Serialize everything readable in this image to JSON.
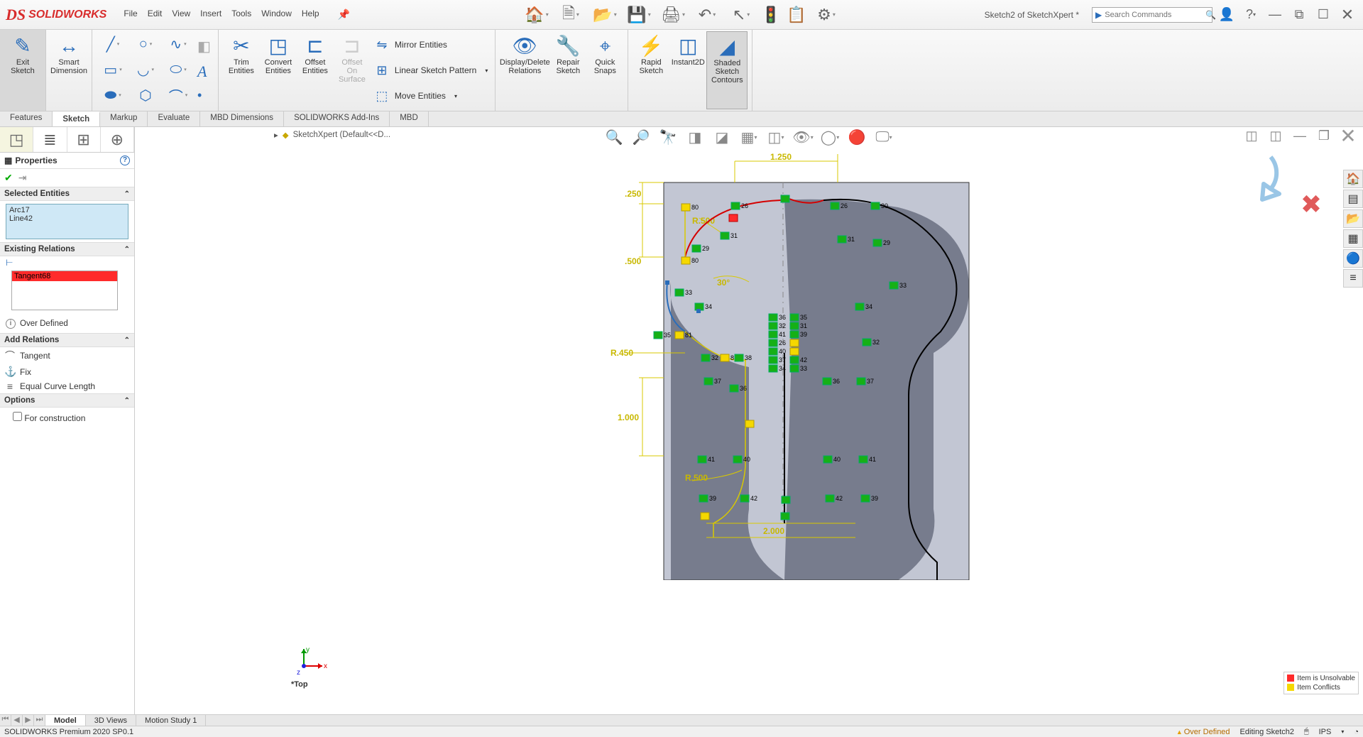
{
  "app": {
    "name": "SOLIDWORKS"
  },
  "menu": [
    "File",
    "Edit",
    "View",
    "Insert",
    "Tools",
    "Window",
    "Help"
  ],
  "doc_title": "Sketch2 of SketchXpert *",
  "search_placeholder": "Search Commands",
  "ribbon": {
    "exit_sketch": "Exit\nSketch",
    "smart_dim": "Smart\nDimension",
    "trim": "Trim\nEntities",
    "convert": "Convert\nEntities",
    "offset": "Offset\nEntities",
    "offset_surf": "Offset\nOn\nSurface",
    "mirror": "Mirror Entities",
    "linear": "Linear Sketch Pattern",
    "move": "Move Entities",
    "display_del": "Display/Delete\nRelations",
    "repair": "Repair\nSketch",
    "quick_snaps": "Quick\nSnaps",
    "rapid": "Rapid\nSketch",
    "instant2d": "Instant2D",
    "shaded": "Shaded\nSketch\nContours"
  },
  "ribbon_tabs": [
    "Features",
    "Sketch",
    "Markup",
    "Evaluate",
    "MBD Dimensions",
    "SOLIDWORKS Add-Ins",
    "MBD"
  ],
  "breadcrumb": "SketchXpert  (Default<<D...",
  "panel": {
    "title": "Properties",
    "sel_head": "Selected Entities",
    "selected": [
      "Arc17",
      "Line42"
    ],
    "rel_head": "Existing Relations",
    "relation": "Tangent68",
    "over_defined": "Over Defined",
    "add_head": "Add Relations",
    "add_relations": [
      "Tangent",
      "Fix",
      "Equal Curve Length"
    ],
    "opt_head": "Options",
    "for_construction": "For construction"
  },
  "triad_label": "*Top",
  "bottom_tabs": [
    "Model",
    "3D Views",
    "Motion Study 1"
  ],
  "statusbar": {
    "left": "SOLIDWORKS Premium 2020 SP0.1",
    "over_defined": "Over Defined",
    "editing": "Editing Sketch2",
    "units": "IPS"
  },
  "legend": {
    "unsolvable": "Item is Unsolvable",
    "conflicts": "Item Conflicts"
  },
  "dimensions": {
    "d250": ".250",
    "d500": ".500",
    "r500": "R.500",
    "r450": "R.450",
    "r500b": "R.500",
    "d1000": "1.000",
    "d1250": "1.250",
    "d2000": "2.000",
    "ang30": "30°"
  }
}
